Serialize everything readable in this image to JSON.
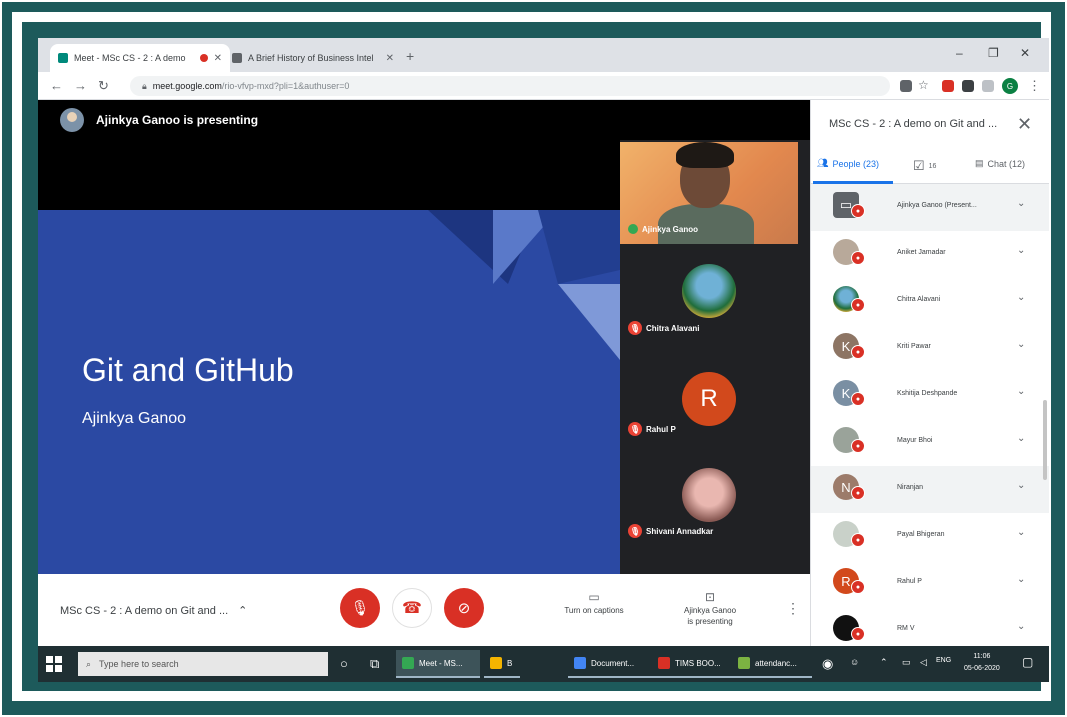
{
  "browser": {
    "tabs": [
      {
        "label": "Meet - MSc CS - 2 : A demo",
        "active": true
      },
      {
        "label": "A Brief History of Business Intel",
        "active": false
      }
    ],
    "url_host": "meet.google.com",
    "url_path": "/rio-vfvp-mxd?pli=1&authuser=0",
    "profile_initial": "G"
  },
  "meet": {
    "presenting_banner": "Ajinkya Ganoo is presenting",
    "slide": {
      "title": "Git and GitHub",
      "author": "Ajinkya Ganoo"
    },
    "tiles": [
      {
        "name": "Ajinkya Ganoo",
        "kind": "video"
      },
      {
        "name": "Chitra Alavani",
        "kind": "avatar"
      },
      {
        "name": "Rahul P",
        "kind": "initial",
        "initial": "R",
        "color": "#d2491c"
      },
      {
        "name": "Shivani Annadkar",
        "kind": "avatar"
      }
    ],
    "controls": {
      "meeting_name": "MSc CS - 2 : A demo on Git and ...",
      "captions_label": "Turn on captions",
      "presenting_label_1": "Ajinkya Ganoo",
      "presenting_label_2": "is presenting"
    }
  },
  "sidebar": {
    "title": "MSc CS - 2 : A demo on Git and ...",
    "tabs": {
      "people": "People (23)",
      "activities": "16",
      "chat": "Chat (12)"
    },
    "people": [
      {
        "name": "Ajinkya Ganoo (Present...",
        "initial": "",
        "color": "#5f6368"
      },
      {
        "name": "Aniket Jamadar",
        "initial": "",
        "color": "#b8a99a"
      },
      {
        "name": "Chitra Alavani",
        "initial": "",
        "color": "#2b6b3a"
      },
      {
        "name": "Kriti Pawar",
        "initial": "K",
        "color": "#8d7564"
      },
      {
        "name": "Kshitija Deshpande",
        "initial": "K",
        "color": "#7a8fa3"
      },
      {
        "name": "Mayur Bhoi",
        "initial": "",
        "color": "#9aa39a"
      },
      {
        "name": "Niranjan",
        "initial": "N",
        "color": "#9c7b6a"
      },
      {
        "name": "Payal Bhigeran",
        "initial": "",
        "color": "#c9d1c9"
      },
      {
        "name": "Rahul P",
        "initial": "R",
        "color": "#d2491c"
      },
      {
        "name": "RM V",
        "initial": "",
        "color": "#111111"
      }
    ]
  },
  "taskbar": {
    "search_placeholder": "Type here to search",
    "apps": [
      {
        "label": "Meet - MS...",
        "color": "#34a853"
      },
      {
        "label": "B",
        "color": "#f4b400"
      },
      {
        "label": "Document...",
        "color": "#4285f4"
      },
      {
        "label": "TIMS BOO...",
        "color": "#d93025"
      },
      {
        "label": "attendanc...",
        "color": "#7cb342"
      }
    ],
    "lang": "ENG",
    "time": "11:06",
    "date": "05-06-2020"
  }
}
